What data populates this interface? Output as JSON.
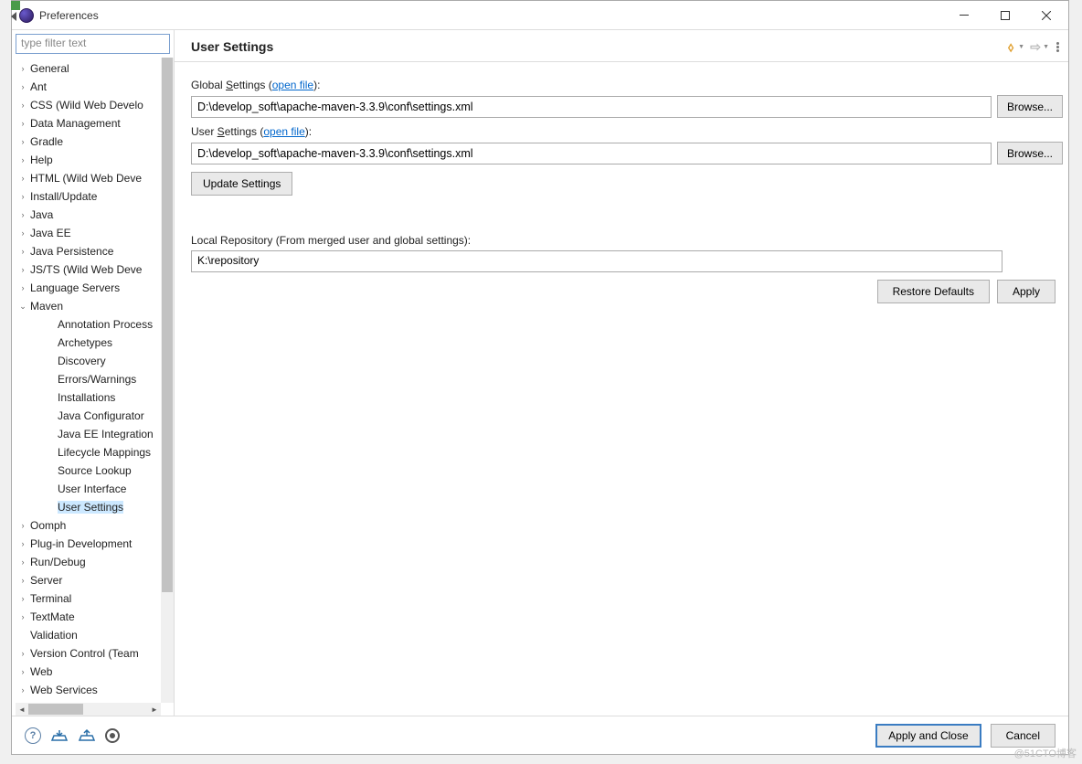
{
  "window": {
    "title": "Preferences"
  },
  "sidebar": {
    "filter_placeholder": "type filter text",
    "items": [
      {
        "label": "General",
        "leaf": false
      },
      {
        "label": "Ant",
        "leaf": false
      },
      {
        "label": "CSS (Wild Web Develo",
        "leaf": false
      },
      {
        "label": "Data Management",
        "leaf": false
      },
      {
        "label": "Gradle",
        "leaf": false
      },
      {
        "label": "Help",
        "leaf": false
      },
      {
        "label": "HTML (Wild Web Deve",
        "leaf": false
      },
      {
        "label": "Install/Update",
        "leaf": false
      },
      {
        "label": "Java",
        "leaf": false
      },
      {
        "label": "Java EE",
        "leaf": false
      },
      {
        "label": "Java Persistence",
        "leaf": false
      },
      {
        "label": "JS/TS (Wild Web Deve",
        "leaf": false
      },
      {
        "label": "Language Servers",
        "leaf": false
      },
      {
        "label": "Maven",
        "leaf": false,
        "expanded": true
      },
      {
        "label": "Annotation Process",
        "leaf": true,
        "child": true
      },
      {
        "label": "Archetypes",
        "leaf": true,
        "child": true
      },
      {
        "label": "Discovery",
        "leaf": true,
        "child": true
      },
      {
        "label": "Errors/Warnings",
        "leaf": true,
        "child": true
      },
      {
        "label": "Installations",
        "leaf": true,
        "child": true
      },
      {
        "label": "Java Configurator",
        "leaf": true,
        "child": true
      },
      {
        "label": "Java EE Integration",
        "leaf": true,
        "child": true
      },
      {
        "label": "Lifecycle Mappings",
        "leaf": true,
        "child": true
      },
      {
        "label": "Source Lookup",
        "leaf": true,
        "child": true
      },
      {
        "label": "User Interface",
        "leaf": true,
        "child": true
      },
      {
        "label": "User Settings",
        "leaf": true,
        "child": true,
        "selected": true
      },
      {
        "label": "Oomph",
        "leaf": false
      },
      {
        "label": "Plug-in Development",
        "leaf": false
      },
      {
        "label": "Run/Debug",
        "leaf": false
      },
      {
        "label": "Server",
        "leaf": false
      },
      {
        "label": "Terminal",
        "leaf": false
      },
      {
        "label": "TextMate",
        "leaf": false
      },
      {
        "label": "Validation",
        "leaf": true
      },
      {
        "label": "Version Control (Team",
        "leaf": false
      },
      {
        "label": "Web",
        "leaf": false
      },
      {
        "label": "Web Services",
        "leaf": false
      }
    ]
  },
  "page": {
    "heading": "User Settings",
    "global_label_pre": "Global ",
    "global_label_u": "S",
    "global_label_post": "ettings (",
    "open_file": "open file",
    "close_paren": "):",
    "global_value": "D:\\develop_soft\\apache-maven-3.3.9\\conf\\settings.xml",
    "user_label_pre": "User ",
    "user_label_u": "S",
    "user_label_post": "ettings (",
    "user_value": "D:\\develop_soft\\apache-maven-3.3.9\\conf\\settings.xml",
    "browse": "Browse...",
    "update": "Update Settings",
    "repo_label": "Local Repository (From merged user and global settings):",
    "repo_value": "K:\\repository",
    "restore": "Restore Defaults",
    "apply": "Apply"
  },
  "footer": {
    "apply_close": "Apply and Close",
    "cancel": "Cancel"
  },
  "watermark": "@51CTO博客"
}
